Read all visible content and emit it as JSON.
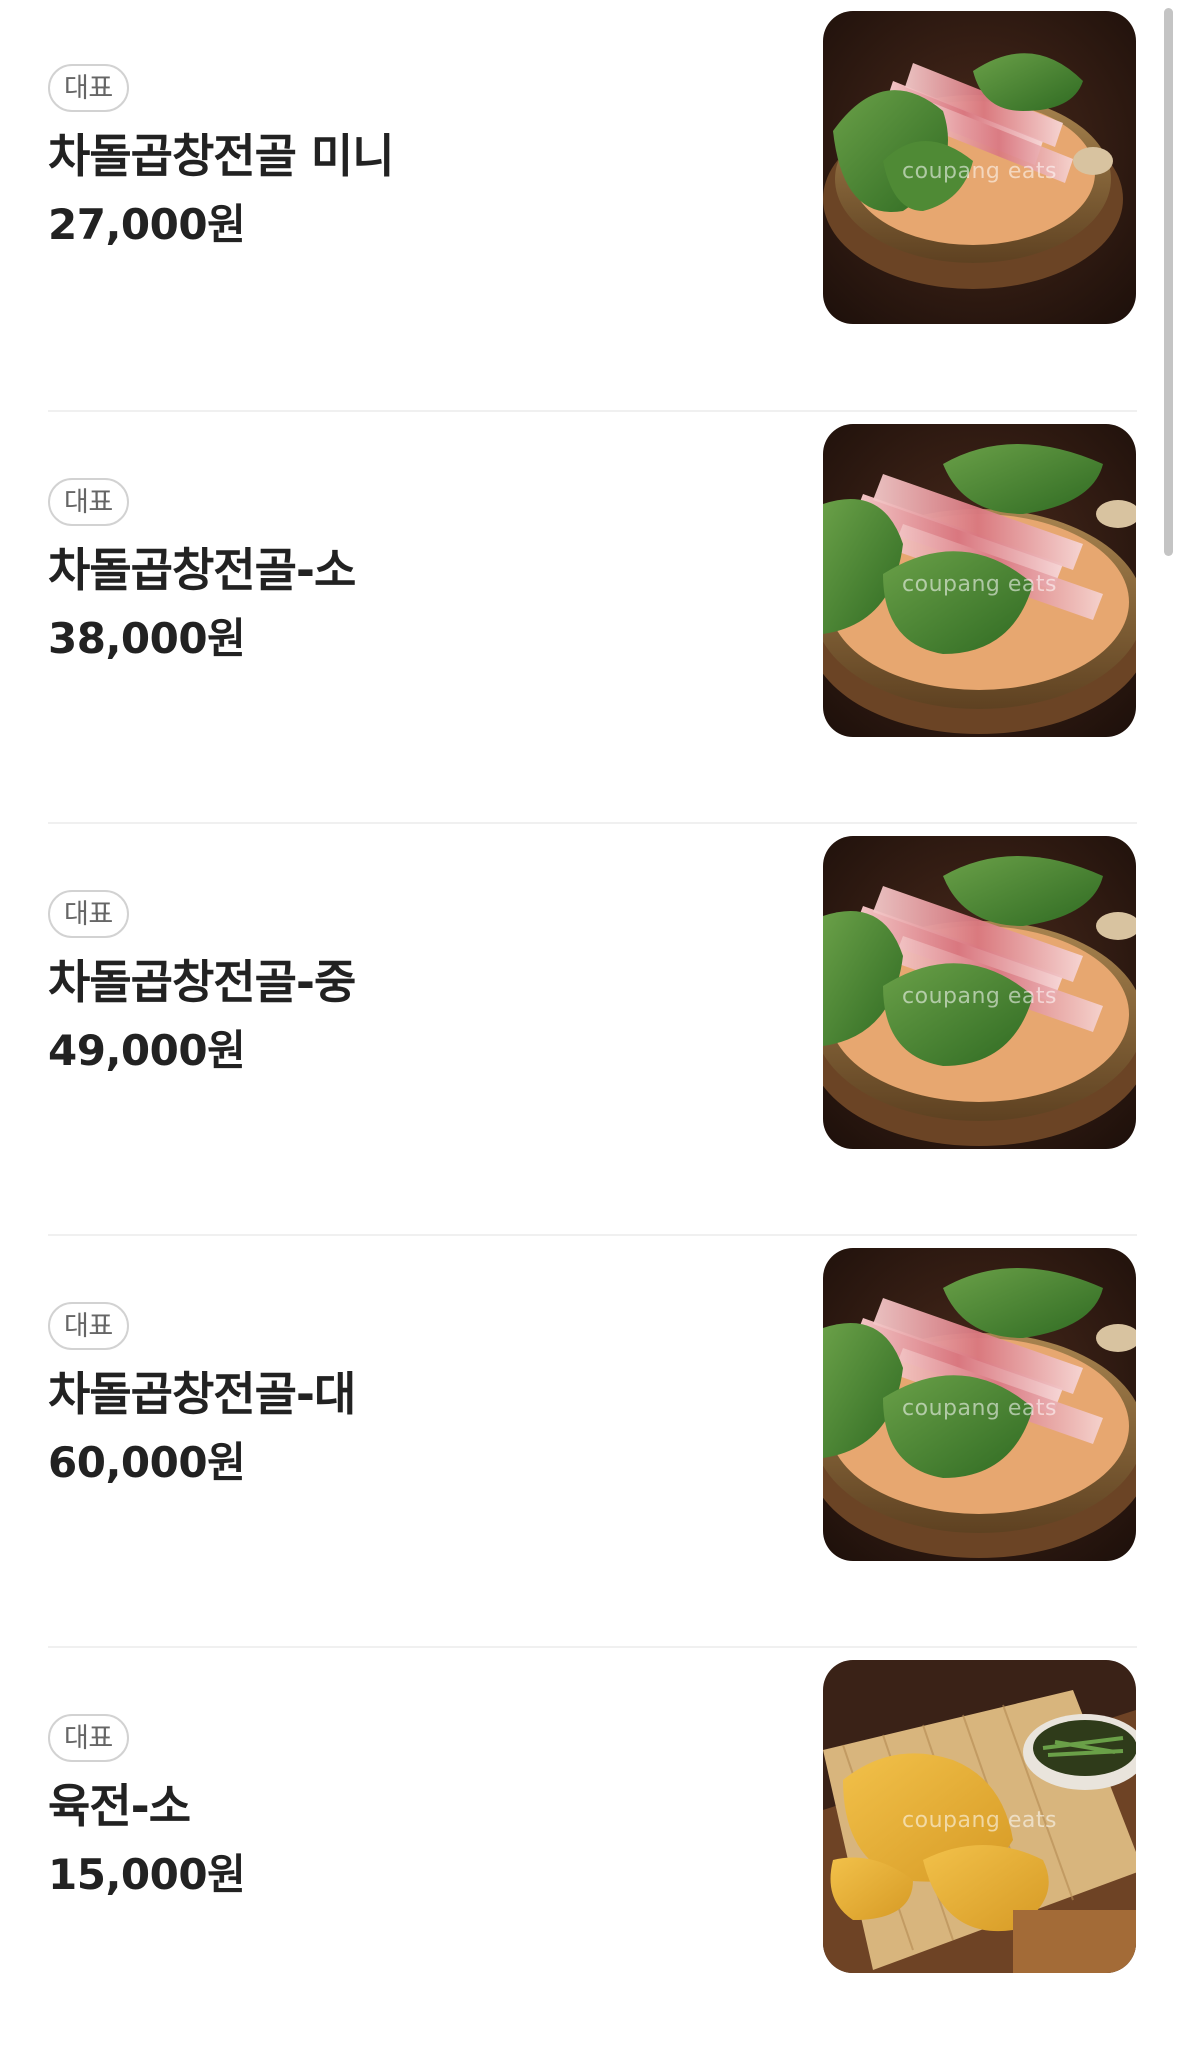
{
  "menu": {
    "items": [
      {
        "badge": "대표",
        "name": "차돌곱창전골 미니",
        "price": "27,000원",
        "image": "hotpot-photo",
        "watermark": "coupang eats"
      },
      {
        "badge": "대표",
        "name": "차돌곱창전골-소",
        "price": "38,000원",
        "image": "hotpot-photo",
        "watermark": "coupang eats"
      },
      {
        "badge": "대표",
        "name": "차돌곱창전골-중",
        "price": "49,000원",
        "image": "hotpot-photo",
        "watermark": "coupang eats"
      },
      {
        "badge": "대표",
        "name": "차돌곱창전골-대",
        "price": "60,000원",
        "image": "hotpot-photo",
        "watermark": "coupang eats"
      },
      {
        "badge": "대표",
        "name": "육전-소",
        "price": "15,000원",
        "image": "yukjeon-photo",
        "watermark": "coupang eats"
      }
    ]
  },
  "colors": {
    "text": "#222222",
    "badge_border": "#d2d2d2",
    "divider": "#f0f0f0",
    "scrollbar": "#c4c4c4"
  }
}
